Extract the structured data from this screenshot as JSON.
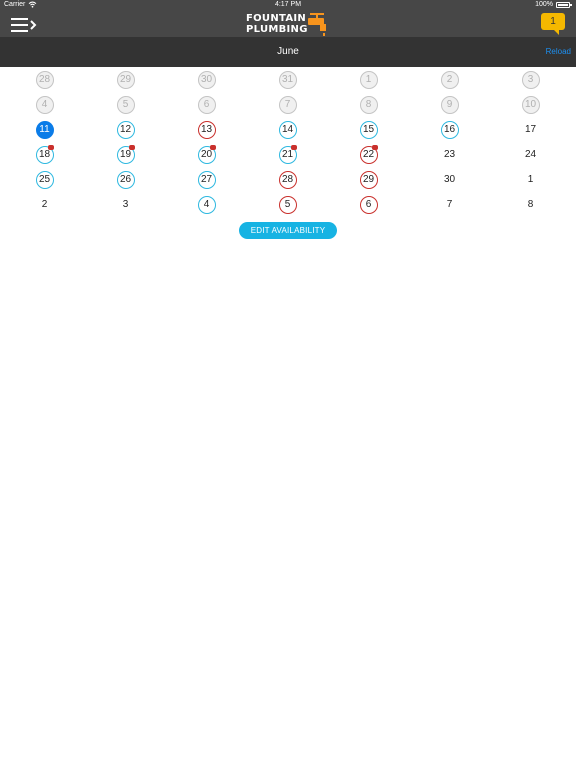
{
  "status_bar": {
    "carrier": "Carrier",
    "time": "4:17 PM",
    "battery": "100%"
  },
  "header": {
    "logo_line1": "FOUNTAIN",
    "logo_line2": "PLUMBING",
    "message_count": "1",
    "menu_icon": "hamburger-menu-icon",
    "message_icon": "chat-bubble-icon",
    "accent_color": "#f7941d",
    "message_color": "#f5b800"
  },
  "subheader": {
    "month": "June",
    "reload": "Reload"
  },
  "calendar": {
    "rows": [
      [
        {
          "d": "28",
          "s": "past"
        },
        {
          "d": "29",
          "s": "past"
        },
        {
          "d": "30",
          "s": "past"
        },
        {
          "d": "31",
          "s": "past"
        },
        {
          "d": "1",
          "s": "past"
        },
        {
          "d": "2",
          "s": "past"
        },
        {
          "d": "3",
          "s": "past"
        }
      ],
      [
        {
          "d": "4",
          "s": "past"
        },
        {
          "d": "5",
          "s": "past"
        },
        {
          "d": "6",
          "s": "past"
        },
        {
          "d": "7",
          "s": "past"
        },
        {
          "d": "8",
          "s": "past"
        },
        {
          "d": "9",
          "s": "past"
        },
        {
          "d": "10",
          "s": "past"
        }
      ],
      [
        {
          "d": "11",
          "s": "today"
        },
        {
          "d": "12",
          "s": "blue"
        },
        {
          "d": "13",
          "s": "red"
        },
        {
          "d": "14",
          "s": "blue"
        },
        {
          "d": "15",
          "s": "blue"
        },
        {
          "d": "16",
          "s": "blue"
        },
        {
          "d": "17",
          "s": "plain"
        }
      ],
      [
        {
          "d": "18",
          "s": "blue",
          "b": true
        },
        {
          "d": "19",
          "s": "blue",
          "b": true
        },
        {
          "d": "20",
          "s": "blue",
          "b": true
        },
        {
          "d": "21",
          "s": "blue",
          "b": true
        },
        {
          "d": "22",
          "s": "red",
          "b": true
        },
        {
          "d": "23",
          "s": "plain"
        },
        {
          "d": "24",
          "s": "plain"
        }
      ],
      [
        {
          "d": "25",
          "s": "blue"
        },
        {
          "d": "26",
          "s": "blue"
        },
        {
          "d": "27",
          "s": "blue"
        },
        {
          "d": "28",
          "s": "red"
        },
        {
          "d": "29",
          "s": "red"
        },
        {
          "d": "30",
          "s": "plain"
        },
        {
          "d": "1",
          "s": "plain"
        }
      ],
      [
        {
          "d": "2",
          "s": "plain"
        },
        {
          "d": "3",
          "s": "plain"
        },
        {
          "d": "4",
          "s": "blue"
        },
        {
          "d": "5",
          "s": "red"
        },
        {
          "d": "6",
          "s": "red"
        },
        {
          "d": "7",
          "s": "plain"
        },
        {
          "d": "8",
          "s": "plain"
        }
      ]
    ],
    "colors": {
      "today": "#0b7ce8",
      "available": "#2eb8e0",
      "booked": "#c9302c",
      "past": "#c4c4c4"
    }
  },
  "edit_button": {
    "label": "EDIT AVAILABILITY",
    "color": "#17b3e3"
  }
}
